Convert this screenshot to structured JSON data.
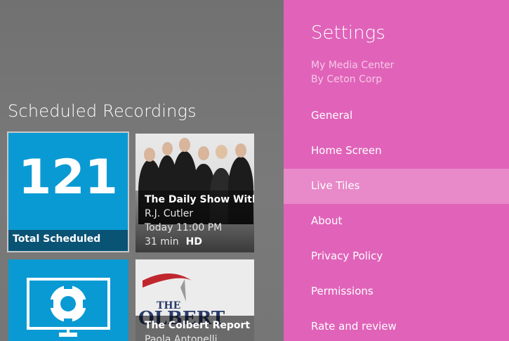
{
  "app": {
    "section_title": "Scheduled Recordings",
    "tiles": {
      "total": {
        "count": "121",
        "caption": "Total Scheduled"
      },
      "show": {
        "title": "The Daily Show With Jon Stewart",
        "subtitle": "R.J. Cutler",
        "time": "Today 11:00 PM",
        "duration": "31 min",
        "quality": "HD"
      },
      "gear_icon": "gear-icon",
      "colbert": {
        "title": "The Colbert Report",
        "subtitle": "Paola Antonelli"
      }
    }
  },
  "settings": {
    "title": "Settings",
    "app_name": "My Media Center",
    "publisher": "By Ceton Corp",
    "selected": "Live Tiles",
    "items": [
      {
        "label": "General"
      },
      {
        "label": "Home Screen"
      },
      {
        "label": "Live Tiles"
      },
      {
        "label": "About"
      },
      {
        "label": "Privacy Policy"
      },
      {
        "label": "Permissions"
      },
      {
        "label": "Rate and review"
      }
    ],
    "colors": {
      "background": "#e063b9",
      "selected": "#e889c9",
      "tile": "#0a9ad3"
    }
  }
}
